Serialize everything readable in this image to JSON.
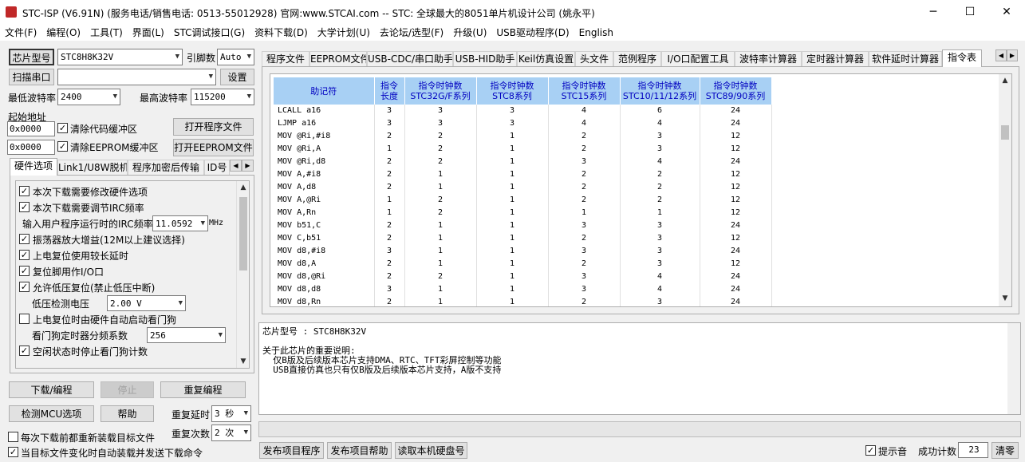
{
  "window": {
    "title": "STC-ISP (V6.91N) (服务电话/销售电话: 0513-55012928) 官网:www.STCAI.com  -- STC: 全球最大的8051单片机设计公司 (姚永平)",
    "minimize": "─",
    "maximize": "☐",
    "close": "✕"
  },
  "menu": [
    "文件(F)",
    "编程(O)",
    "工具(T)",
    "界面(L)",
    "STC调试接口(G)",
    "资料下载(D)",
    "大学计划(U)",
    "去论坛/选型(F)",
    "升级(U)",
    "USB驱动程序(D)",
    "English"
  ],
  "left": {
    "chip_btn": "芯片型号",
    "chip_value": "STC8H8K32V",
    "pins_label": "引脚数",
    "pins_value": "Auto",
    "scan_btn": "扫描串口",
    "port_value": "",
    "settings_btn": "设置",
    "min_baud_label": "最低波特率",
    "min_baud_value": "2400",
    "max_baud_label": "最高波特率",
    "max_baud_value": "115200",
    "start_addr_label": "起始地址",
    "addr1": "0x0000",
    "clear_code": "清除代码缓冲区",
    "open_prog_btn": "打开程序文件",
    "addr2": "0x0000",
    "clear_eeprom": "清除EEPROM缓冲区",
    "open_eeprom_btn": "打开EEPROM文件",
    "tabs": [
      "硬件选项",
      "Link1/U8W脱机",
      "程序加密后传输",
      "ID号"
    ],
    "options": [
      "本次下载需要修改硬件选项",
      "本次下载需要调节IRC频率",
      "振荡器放大增益(12M以上建议选择)",
      "上电复位使用较长延时",
      "复位脚用作I/O口",
      "允许低压复位(禁止低压中断)",
      "上电复位时由硬件自动启动看门狗",
      "空闲状态时停止看门狗计数"
    ],
    "irc_label": "输入用户程序运行时的IRC频率",
    "irc_value": "11.0592",
    "irc_unit": "MHz",
    "lvd_label": "低压检测电压",
    "lvd_value": "2.00 V",
    "wdt_label": "看门狗定时器分频系数",
    "wdt_value": "256",
    "download_btn": "下载/编程",
    "stop_btn": "停止",
    "reprog_btn": "重复编程",
    "detect_btn": "检测MCU选项",
    "help_btn": "帮助",
    "delay_label": "重复延时",
    "delay_value": "3 秒",
    "count_label": "重复次数",
    "count_value": "2 次",
    "reload_label": "每次下载前都重新装载目标文件",
    "autosend_label": "当目标文件变化时自动装载并发送下载命令"
  },
  "right": {
    "tabs": [
      "程序文件",
      "EEPROM文件",
      "USB-CDC/串口助手",
      "USB-HID助手",
      "Keil仿真设置",
      "头文件",
      "范例程序",
      "I/O口配置工具",
      "波特率计算器",
      "定时器计算器",
      "软件延时计算器",
      "指令表"
    ],
    "table_headers": [
      {
        "l1": "助记符",
        "l2": ""
      },
      {
        "l1": "指令",
        "l2": "长度"
      },
      {
        "l1": "指令时钟数",
        "l2": "STC32G/F系列"
      },
      {
        "l1": "指令时钟数",
        "l2": "STC8系列"
      },
      {
        "l1": "指令时钟数",
        "l2": "STC15系列"
      },
      {
        "l1": "指令时钟数",
        "l2": "STC10/11/12系列"
      },
      {
        "l1": "指令时钟数",
        "l2": "STC89/90系列"
      }
    ],
    "rows": [
      [
        "LCALL a16",
        "3",
        "3",
        "3",
        "4",
        "6",
        "24"
      ],
      [
        "LJMP a16",
        "3",
        "3",
        "3",
        "4",
        "4",
        "24"
      ],
      [
        "MOV @Ri,#i8",
        "2",
        "2",
        "1",
        "2",
        "3",
        "12"
      ],
      [
        "MOV @Ri,A",
        "1",
        "2",
        "1",
        "2",
        "3",
        "12"
      ],
      [
        "MOV @Ri,d8",
        "2",
        "2",
        "1",
        "3",
        "4",
        "24"
      ],
      [
        "MOV A,#i8",
        "2",
        "1",
        "1",
        "2",
        "2",
        "12"
      ],
      [
        "MOV A,d8",
        "2",
        "1",
        "1",
        "2",
        "2",
        "12"
      ],
      [
        "MOV A,@Ri",
        "1",
        "2",
        "1",
        "2",
        "2",
        "12"
      ],
      [
        "MOV A,Rn",
        "1",
        "2",
        "1",
        "1",
        "1",
        "12"
      ],
      [
        "MOV b51,C",
        "2",
        "1",
        "1",
        "3",
        "3",
        "24"
      ],
      [
        "MOV C,b51",
        "2",
        "1",
        "1",
        "2",
        "3",
        "12"
      ],
      [
        "MOV d8,#i8",
        "3",
        "1",
        "1",
        "3",
        "3",
        "24"
      ],
      [
        "MOV d8,A",
        "2",
        "1",
        "1",
        "2",
        "3",
        "12"
      ],
      [
        "MOV d8,@Ri",
        "2",
        "2",
        "1",
        "3",
        "4",
        "24"
      ],
      [
        "MOV d8,d8",
        "3",
        "1",
        "1",
        "3",
        "4",
        "24"
      ],
      [
        "MOV d8,Rn",
        "2",
        "1",
        "1",
        "2",
        "3",
        "24"
      ]
    ],
    "info_chip_line": "芯片型号 : STC8H8K32V",
    "info_lines": [
      "关于此芯片的重要说明:",
      "  仅B版及后续版本芯片支持DMA、RTC、TFT彩屏控制等功能",
      "  USB直接仿真也只有仅B版及后续版本芯片支持，A版不支持"
    ],
    "publish_btn": "发布项目程序",
    "publish_help_btn": "发布项目帮助",
    "read_disk_btn": "读取本机硬盘号",
    "beep_label": "提示音",
    "success_label": "成功计数",
    "success_value": "23",
    "clear_btn": "清零"
  }
}
